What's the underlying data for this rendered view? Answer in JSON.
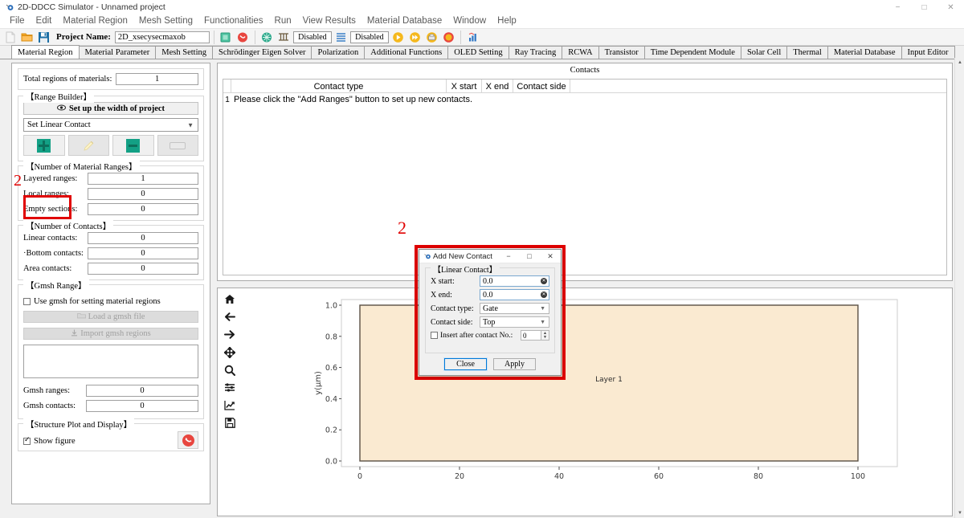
{
  "window": {
    "title": "2D-DDCC Simulator - Unnamed project",
    "app_icon": "app-icon",
    "minimize": "−",
    "maximize": "□",
    "close": "✕"
  },
  "menubar": {
    "items": [
      "File",
      "Edit",
      "Material Region",
      "Mesh Setting",
      "Functionalities",
      "Run",
      "View Results",
      "Material Database",
      "Window",
      "Help"
    ]
  },
  "toolbar": {
    "new_icon": "new-document-icon",
    "open_icon": "open-folder-icon",
    "save_icon": "save-disk-icon",
    "project_label": "Project Name:",
    "project_value": "2D_xsecysecmaxob",
    "structure_icon": "structure-icon",
    "refresh_icon": "refresh-icon",
    "mesh_icon": "mesh-icon",
    "grid_icon": "grid-icon",
    "disabled_1": "Disabled",
    "lines_icon": "lines-icon",
    "disabled_2": "Disabled",
    "run_icon": "run-icon",
    "run_fast_icon": "run-fast-icon",
    "run_batch_icon": "run-batch-icon",
    "stop_icon": "stop-icon",
    "chart_icon": "chart-icon"
  },
  "tabs": [
    {
      "label": "Material Region",
      "active": true
    },
    {
      "label": "Material Parameter",
      "active": false
    },
    {
      "label": "Mesh Setting",
      "active": false
    },
    {
      "label": "Schrödinger Eigen Solver",
      "active": false
    },
    {
      "label": "Polarization",
      "active": false
    },
    {
      "label": "Additional Functions",
      "active": false
    },
    {
      "label": "OLED Setting",
      "active": false
    },
    {
      "label": "Ray Tracing",
      "active": false
    },
    {
      "label": "RCWA",
      "active": false
    },
    {
      "label": "Transistor",
      "active": false
    },
    {
      "label": "Time Dependent Module",
      "active": false
    },
    {
      "label": "Solar Cell",
      "active": false
    },
    {
      "label": "Thermal",
      "active": false
    },
    {
      "label": "Material Database",
      "active": false
    },
    {
      "label": "Input Editor",
      "active": false
    }
  ],
  "left_panel": {
    "total_regions_label": "Total regions of materials:",
    "total_regions_value": "1",
    "range_builder_title": "【Range Builder】",
    "setup_width_btn": "Set up the width of project",
    "setup_width_icon": "width-icon",
    "contact_combo_value": "Set Linear Contact",
    "add_icon": "plus-icon",
    "edit_icon": "pencil-icon",
    "remove_icon": "minus-icon",
    "clear_icon": "bar-icon",
    "annotation_left": "2",
    "material_ranges_title": "【Number of Material Ranges】",
    "material_ranges": [
      {
        "label": "Layered ranges:",
        "value": "1"
      },
      {
        "label": "Local ranges:",
        "value": "0"
      },
      {
        "label": "Empty sections:",
        "value": "0"
      }
    ],
    "contacts_title": "【Number of Contacts】",
    "contacts_fields": [
      {
        "label": "Linear contacts:",
        "value": "0"
      },
      {
        "label": "·Bottom contacts:",
        "value": "0"
      },
      {
        "label": "Area contacts:",
        "value": "0"
      }
    ],
    "gmsh_title": "【Gmsh Range】",
    "gmsh_checkbox_label": "Use gmsh for setting material regions",
    "gmsh_checked": false,
    "load_gmsh_btn": "Load a gmsh file",
    "load_gmsh_icon": "folder-icon",
    "import_gmsh_btn": "Import gmsh regions",
    "import_gmsh_icon": "download-icon",
    "gmsh_fields": [
      {
        "label": "Gmsh ranges:",
        "value": "0"
      },
      {
        "label": "Gmsh contacts:",
        "value": "0"
      }
    ],
    "structure_plot_title": "【Structure Plot and Display】",
    "show_figure_label": "Show figure",
    "show_figure_checked": true,
    "refresh_plot_icon": "refresh-circle-icon"
  },
  "contacts_panel": {
    "title": "Contacts",
    "columns": [
      "Contact type",
      "X start",
      "X end",
      "Contact side"
    ],
    "rows": [
      {
        "num": "1",
        "message": "Please click the \"Add Ranges\" button to set up new contacts."
      }
    ]
  },
  "dialog": {
    "annotation": "2",
    "title": "Add New Contact",
    "title_icon": "dialog-icon",
    "minimize": "−",
    "maximize": "□",
    "close": "✕",
    "group_title": "【Linear Contact】",
    "x_start_label": "X start:",
    "x_start_value": "0.0",
    "x_end_label": "X end:",
    "x_end_value": "0.0",
    "contact_type_label": "Contact type:",
    "contact_type_value": "Gate",
    "contact_side_label": "Contact side:",
    "contact_side_value": "Top",
    "insert_after_label": "Insert after contact No.:",
    "insert_after_checked": false,
    "insert_after_value": "0",
    "close_btn": "Close",
    "apply_btn": "Apply",
    "clear_icon": "clear-circle-icon"
  },
  "plot": {
    "toolbar_icons": [
      "home-icon",
      "back-arrow-icon",
      "forward-arrow-icon",
      "pan-move-icon",
      "zoom-magnifier-icon",
      "configure-subplots-icon",
      "edit-curves-icon",
      "save-figure-icon"
    ],
    "chart_data": {
      "type": "area",
      "title": "",
      "xlabel": "",
      "ylabel": "y(μm)",
      "xlim": [
        -5,
        107
      ],
      "ylim": [
        -0.06,
        1.05
      ],
      "xticks": [
        0,
        20,
        40,
        60,
        80,
        100
      ],
      "xtick_labels": [
        "0",
        "20",
        "40",
        "60",
        "80",
        "100"
      ],
      "yticks": [
        0.0,
        0.2,
        0.4,
        0.6,
        0.8,
        1.0
      ],
      "ytick_labels": [
        "0.0",
        "0.2",
        "0.4",
        "0.6",
        "0.8",
        "1.0"
      ],
      "grid": false,
      "regions": [
        {
          "label": "Layer 1",
          "x_start": 0,
          "x_end": 100,
          "y_start": 0.0,
          "y_end": 1.0,
          "fill": "#faead1",
          "stroke": "#5a5145"
        }
      ]
    }
  },
  "colors": {
    "accent_green": "#13a085",
    "annotation_red": "#e00000",
    "layer_fill": "#faead1",
    "plot_border": "#5a5145"
  }
}
